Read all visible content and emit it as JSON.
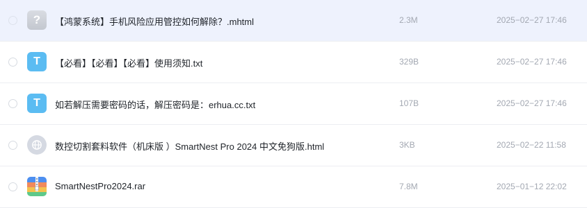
{
  "files": [
    {
      "name": "【鸿蒙系统】手机风险应用管控如何解除？.mhtml",
      "size": "2.3M",
      "date": "2025−02−27 17:46",
      "icon": "unknown-file-icon",
      "icon_glyph": "?"
    },
    {
      "name": "【必看】【必看】【必看】使用须知.txt",
      "size": "329B",
      "date": "2025−02−27 17:46",
      "icon": "text-file-icon",
      "icon_glyph": "T"
    },
    {
      "name": "如若解压需要密码的话，解压密码是：erhua.cc.txt",
      "size": "107B",
      "date": "2025−02−27 17:46",
      "icon": "text-file-icon",
      "icon_glyph": "T"
    },
    {
      "name": "数控切割套料软件（机床版 ）SmartNest Pro 2024 中文免狗版.html",
      "size": "3KB",
      "date": "2025−02−22 11:58",
      "icon": "globe-icon"
    },
    {
      "name": "SmartNestPro2024.rar",
      "size": "7.8M",
      "date": "2025−01−12 22:02",
      "icon": "archive-icon"
    }
  ],
  "colors": {
    "selected_row_bg": "#eef2fd",
    "txt_icon": "#5bbcf2",
    "meta_text": "#a3a8b2"
  }
}
